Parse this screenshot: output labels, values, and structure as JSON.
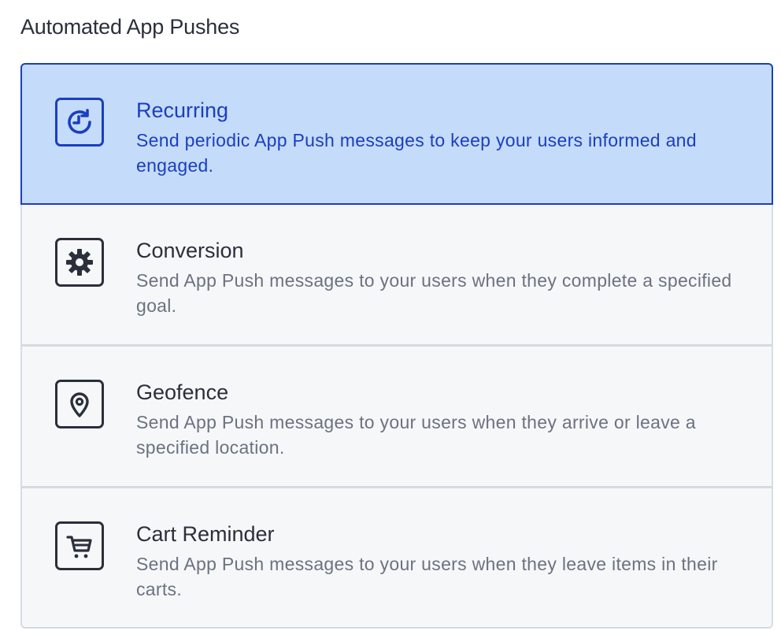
{
  "section": {
    "title": "Automated App Pushes"
  },
  "options": [
    {
      "id": "recurring",
      "title": "Recurring",
      "description": "Send periodic App Push messages to keep your users informed and engaged.",
      "icon": "recurring-clock-icon",
      "selected": true
    },
    {
      "id": "conversion",
      "title": "Conversion",
      "description": "Send App Push messages to your users when they complete a specified goal.",
      "icon": "gear-icon",
      "selected": false
    },
    {
      "id": "geofence",
      "title": "Geofence",
      "description": "Send App Push messages to your users when they arrive or leave a specified location.",
      "icon": "location-pin-icon",
      "selected": false
    },
    {
      "id": "cart-reminder",
      "title": "Cart Reminder",
      "description": "Send App Push messages to your users when they leave items in their carts.",
      "icon": "shopping-cart-icon",
      "selected": false
    }
  ],
  "colors": {
    "selected_bg": "#c5dbfa",
    "selected_accent": "#1a3fc0",
    "option_bg": "#f6f7f9",
    "text_dark": "#2a2f3b",
    "text_muted": "#6b7280"
  }
}
